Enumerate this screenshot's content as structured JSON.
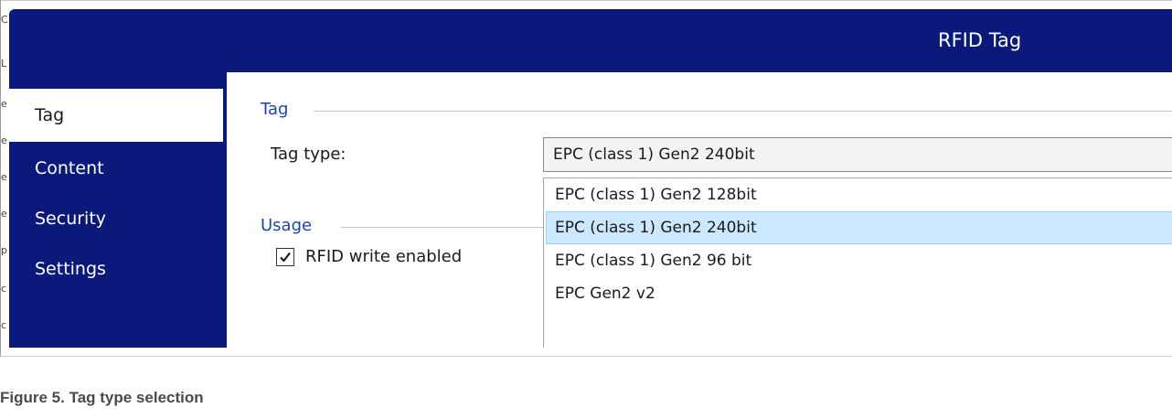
{
  "dialog": {
    "title": "RFID Tag"
  },
  "sidebar": {
    "items": [
      {
        "label": "Tag",
        "selected": true
      },
      {
        "label": "Content",
        "selected": false
      },
      {
        "label": "Security",
        "selected": false
      },
      {
        "label": "Settings",
        "selected": false
      }
    ]
  },
  "tag_group": {
    "title": "Tag",
    "tag_type_label": "Tag type:",
    "tag_type_value": "EPC (class 1) Gen2 240bit",
    "options": [
      {
        "label": "EPC (class 1) Gen2 128bit",
        "highlighted": false
      },
      {
        "label": "EPC (class 1) Gen2 240bit",
        "highlighted": true
      },
      {
        "label": "EPC (class 1) Gen2 96 bit",
        "highlighted": false
      },
      {
        "label": "EPC Gen2 v2",
        "highlighted": false
      }
    ]
  },
  "usage_group": {
    "title": "Usage",
    "rfid_write_label": "RFID write enabled",
    "rfid_write_checked": true
  },
  "edge_glyphs": [
    "C",
    "L",
    "e",
    "e",
    "e",
    "e",
    "p",
    "c",
    "c"
  ],
  "caption": "Figure 5.  Tag type selection",
  "colors": {
    "titlebar": "#0b1a7a",
    "sidebar": "#0b1a7a",
    "group_title": "#1f44a8",
    "option_highlight": "#cce8ff"
  },
  "icons": {
    "checkbox_mark": "check-mark-icon"
  }
}
